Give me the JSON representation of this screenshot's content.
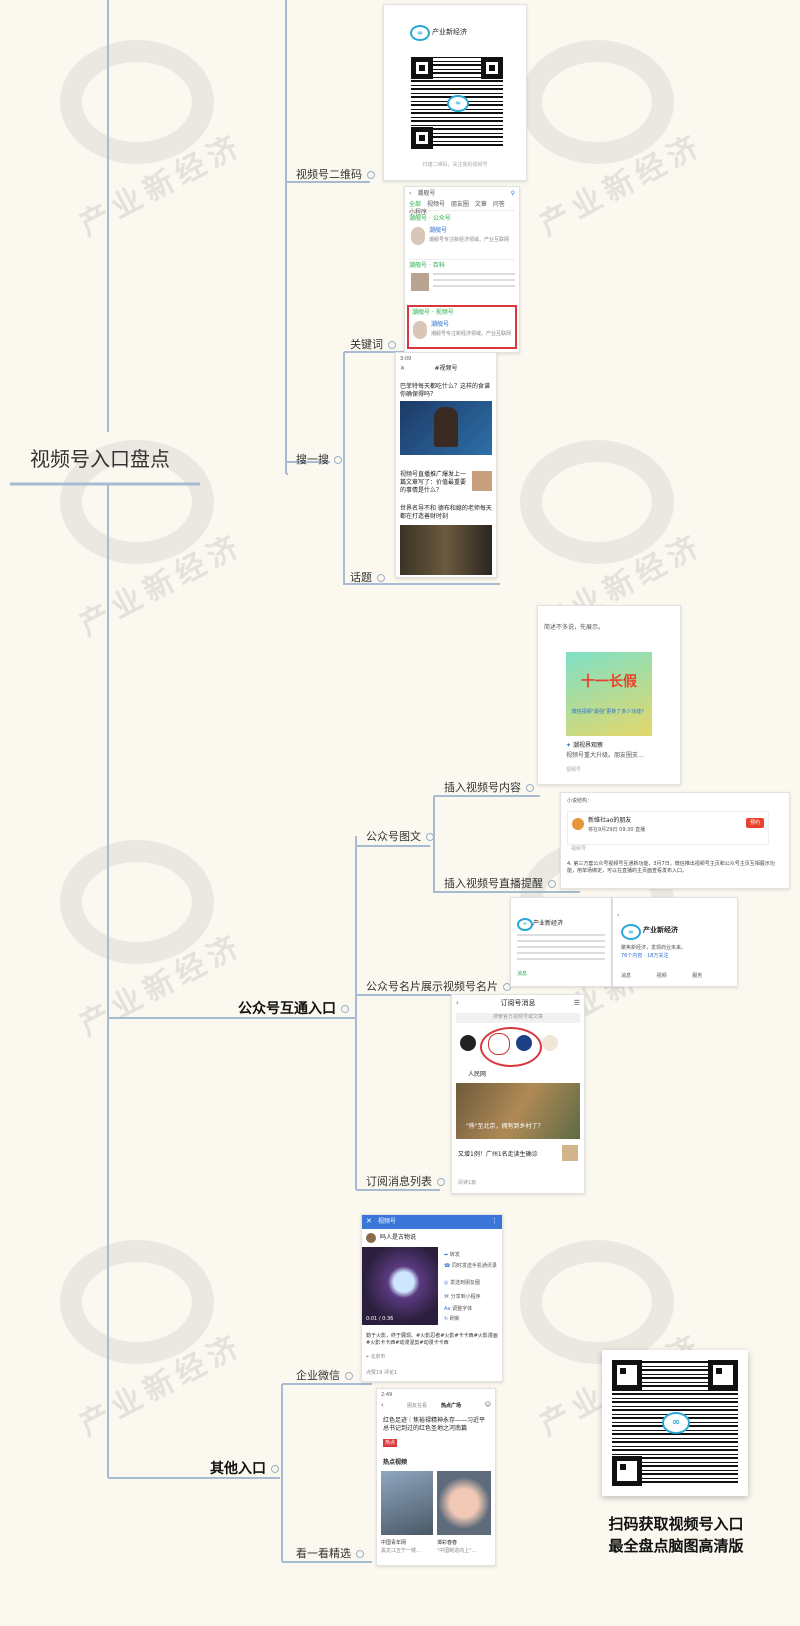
{
  "root": {
    "title": "视频号入口盘点"
  },
  "watermark": {
    "text": "产业新经济"
  },
  "branches": {
    "top_group": {
      "qr_code": "视频号二维码",
      "keyword": "关键词",
      "search": "搜一搜",
      "topic": "话题"
    },
    "official": {
      "label": "公众号互通入口",
      "article": "公众号图文",
      "insert_content": "插入视频号内容",
      "insert_live": "插入视频号直播提醒",
      "name_card": "公众号名片展示视频号名片",
      "subscribe_list": "订阅消息列表"
    },
    "other": {
      "label": "其他入口",
      "wecom": "企业微信",
      "look": "看一看精选"
    }
  },
  "cards": {
    "qr_card": {
      "account": "产业新经济",
      "hint": "扫描二维码，关注我的视频号"
    },
    "keyword_card": {
      "search_text": "潮舰号",
      "tabs": [
        "全部",
        "视频号",
        "朋友圈",
        "文章",
        "问答",
        "小程序"
      ],
      "section_official": "潮舰号 · 公众号",
      "section_baike": "潮舰号 · 百科",
      "section_channel": "潮舰号 · 视频号",
      "name": "潮舰号",
      "desc": "潮舰号专注新经济领域。产业互联网"
    },
    "search_card": {
      "time": "3:09",
      "title": "#视频号",
      "q1": "巴菲特每天都吃什么？这样的食谱你确保得吗？",
      "q2": "视频号直播推广爆发上一篇文章写了：价值最重要的事情是什么？",
      "q3": "世界名导不和 德布和媳的老师每天都在打造善财时刻"
    },
    "article_card": {
      "intro": "简述不多说，先展示。",
      "poster": "十一长假",
      "poster_sub": "微信视频\"最强\"更新了多少功能？",
      "name": "潮视界观察",
      "desc": "视频号重大升级。朋友圈支...",
      "source": "视频号"
    },
    "live_card": {
      "name": "新维社ao的朋友",
      "badge": "预约",
      "time": "将在9月29日 09:30 直播",
      "source": "视频号",
      "body": "4. 第三方套公众号视频号互通新功能，3月7日，微信推出视频号主页和公众号主页互相展示功能，用单场绑定，可以在直播的主页面查看发布入口。",
      "prefix": "小说结构："
    },
    "namecard_card": {
      "account": "产业新经济",
      "desc": "聚焦新经济，发现商业未来。",
      "stats": "76个内容 · 18万关注",
      "tabs": [
        "消息",
        "视频",
        "服务"
      ]
    },
    "subscribe_card": {
      "title": "订阅号消息",
      "search": "搜索官方视频号或文章",
      "account": "人民网",
      "headline": "\"熊\"至北京，拥有到乡村了？",
      "headline2": "又增1例！广州1名走读生确诊",
      "footer": "阅读1篇"
    },
    "wecom_card": {
      "header": "视频号",
      "author": "吗人是古物说",
      "menu": [
        "转发",
        "同时发送手机通讯录",
        "发送到朋友圈",
        "分享到小程序",
        "调整字体",
        "刷新"
      ],
      "time_text": "0:01 / 0:36",
      "caption": "勒于火影，终于展现。#火影忍者#火影#卡卡西#火影漫画#火影卡卡西#动漫混剪#动漫卡卡西",
      "location": "北京市",
      "stats": "点赞19   评论1"
    },
    "look_card": {
      "time": "2:49",
      "tab1": "朋友在看",
      "tab2": "热点广场",
      "headline": "红色足迹｜焦裕禄精神永存——习近平总书记到过的红色圣地之河南篇",
      "tag": "热点",
      "section": "热点视频",
      "v1": "中国青年网",
      "v1_desc": "黑龙江五宁一楼…",
      "v2": "谭彩春春",
      "v2_desc": "\"中国制造向上\"…"
    }
  },
  "promo": {
    "line1": "扫码获取视频号入口",
    "line2": "最全盘点脑图高清版"
  },
  "colors": {
    "line": "#a8bbd3",
    "background": "#fbf8ef",
    "accent_blue": "#2e6fd0",
    "accent_red": "#d9363e",
    "accent_green": "#26b04a"
  }
}
